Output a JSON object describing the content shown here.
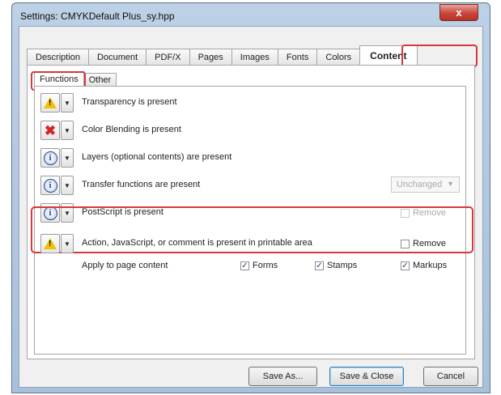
{
  "window": {
    "title": "Settings:  CMYKDefault Plus_sy.hpp",
    "close_label": "x"
  },
  "tabs": [
    "Description",
    "Document",
    "PDF/X",
    "Pages",
    "Images",
    "Fonts",
    "Colors",
    "Content"
  ],
  "active_tab": "Content",
  "subtabs": [
    "Functions",
    "Other"
  ],
  "active_subtab": "Functions",
  "rows": [
    {
      "icon": "warning-icon",
      "text": "Transparency is present"
    },
    {
      "icon": "error-x-icon",
      "text": "Color Blending is present"
    },
    {
      "icon": "info-icon",
      "text": "Layers (optional contents) are present"
    },
    {
      "icon": "info-icon",
      "text": "Transfer functions are present",
      "select_value": "Unchanged"
    },
    {
      "icon": "info-icon",
      "text": "PostScript is present",
      "checkbox_label": "Remove",
      "checkbox_checked": false,
      "checkbox_disabled": true
    },
    {
      "icon": "warning-icon",
      "text": "Action, JavaScript, or comment is present in printable area",
      "checkbox_label": "Remove",
      "checkbox_checked": false
    }
  ],
  "apply": {
    "label": "Apply to page content",
    "options": [
      {
        "label": "Forms",
        "checked": true
      },
      {
        "label": "Stamps",
        "checked": true
      },
      {
        "label": "Markups",
        "checked": true
      }
    ]
  },
  "buttons": {
    "save_as": "Save As...",
    "save_close": "Save & Close",
    "cancel": "Cancel"
  },
  "colors": {
    "highlight": "#d9363c",
    "title_bar": "#bcd0e6",
    "warning": "#f2c200",
    "error": "#d3262b",
    "info": "#27468c"
  }
}
